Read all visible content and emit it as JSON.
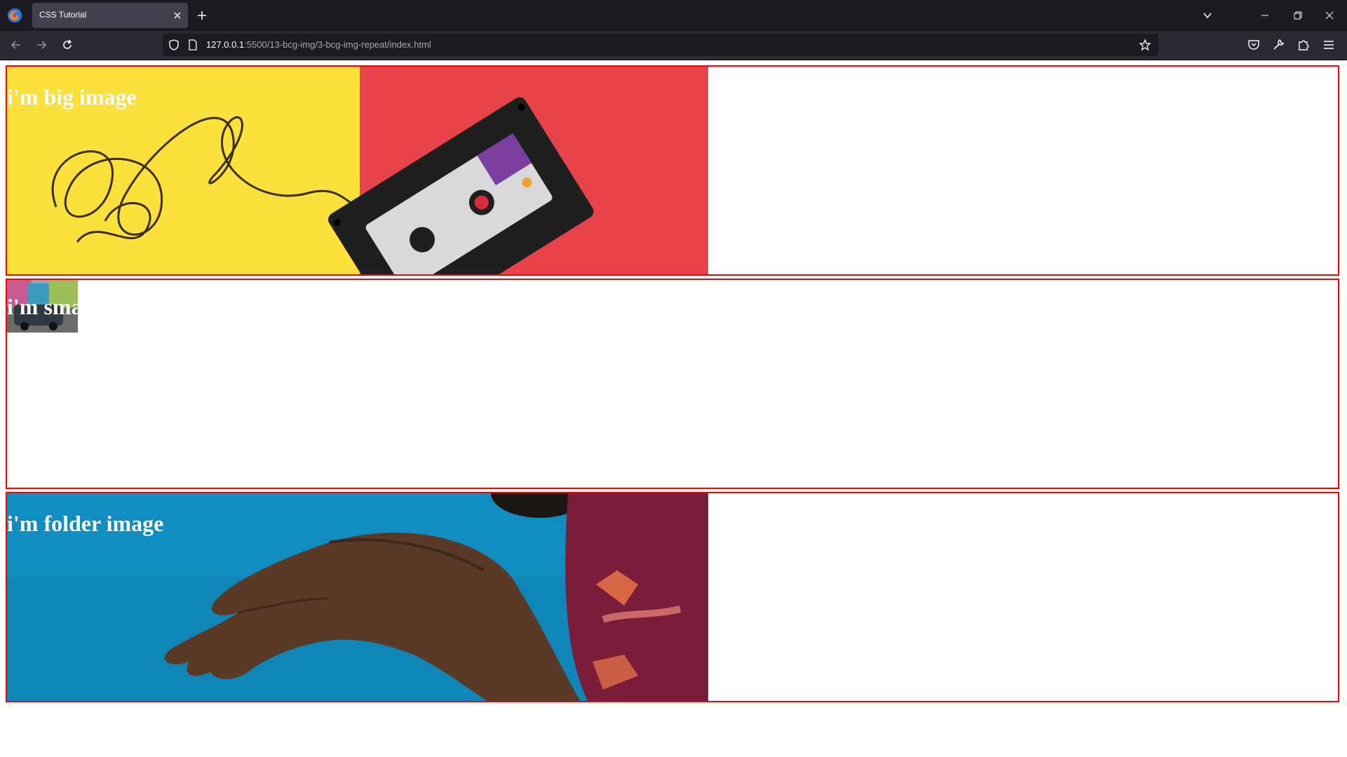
{
  "browser": {
    "tab_title": "CSS Tutorial",
    "url_host": "127.0.0.1",
    "url_path": ":5500/13-bcg-img/3-bcg-img-repeat/index.html"
  },
  "icons": {
    "firefox_logo": "firefox-logo-icon",
    "tab_close": "close-icon",
    "new_tab": "plus-icon",
    "list_tabs": "chevron-down-icon",
    "back": "arrow-left-icon",
    "forward": "arrow-right-icon",
    "reload": "reload-icon",
    "tracking": "shield-icon",
    "page": "page-icon",
    "bookmark": "star-icon",
    "pocket": "pocket-icon",
    "devtools": "wrench-icon",
    "extensions": "puzzle-icon",
    "menu": "hamburger-icon"
  },
  "colors": {
    "card_border": "#ff0000",
    "heading_text": "#ffffff",
    "chrome_dark": "#1c1b22",
    "toolbar": "#2b2a33",
    "big_image_yellow": "#fbe13c",
    "big_image_red": "#e8434a",
    "folder_image_blue": "#0e86b8"
  },
  "page": {
    "cards": [
      {
        "heading": "i'm big image",
        "background": "cassette tape photo"
      },
      {
        "heading": "i'm small image",
        "background": "small street photo"
      },
      {
        "heading": "i'm folder image",
        "background": "hand photo"
      }
    ]
  }
}
